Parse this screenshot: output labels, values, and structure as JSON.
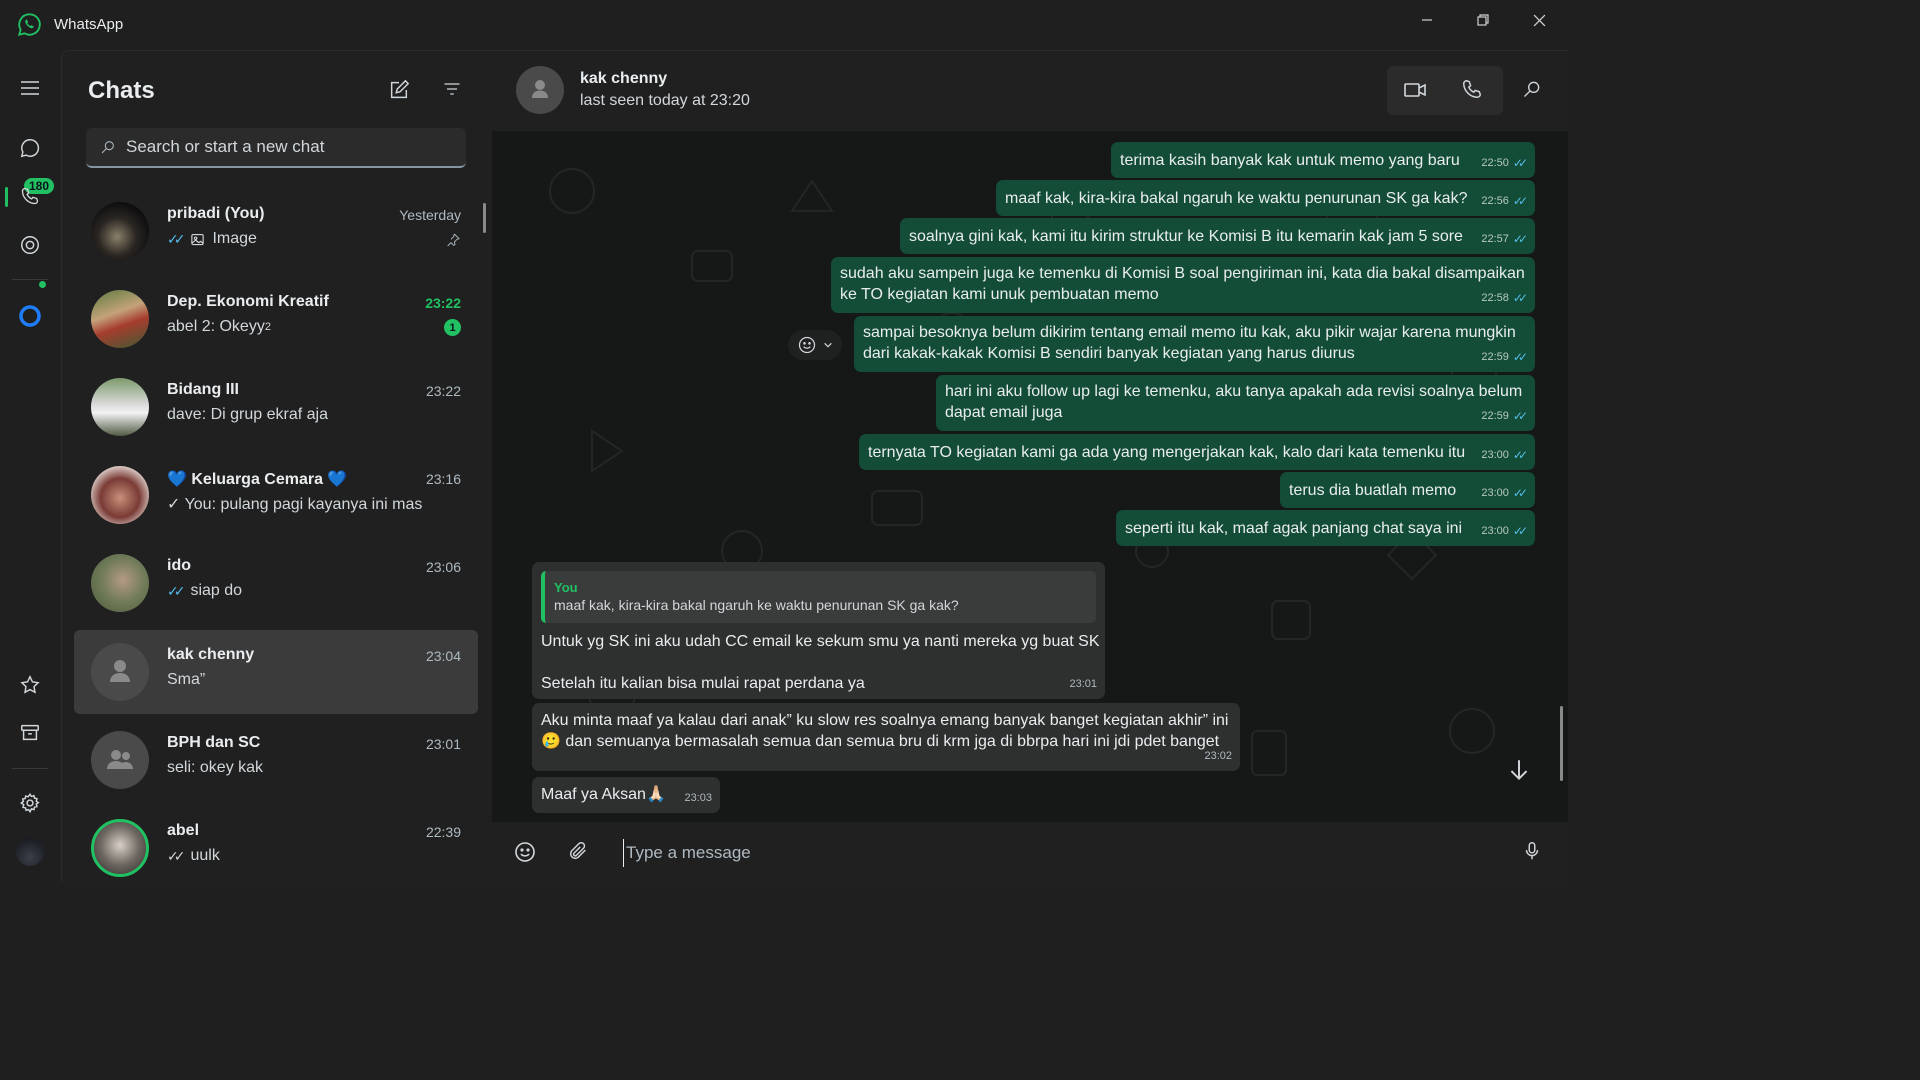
{
  "window": {
    "title": "WhatsApp",
    "icons": [
      "whatsapp-logo",
      "minimize-icon",
      "maximize-icon",
      "close-icon"
    ]
  },
  "rail": {
    "chats_badge": "180",
    "items": [
      "menu-icon",
      "chats-icon",
      "calls-icon",
      "status-icon",
      "meta-ai-icon",
      "starred-icon",
      "archive-icon",
      "settings-icon",
      "profile-avatar"
    ]
  },
  "sidebar": {
    "title": "Chats",
    "search_placeholder": "Search or start a new chat",
    "chats": [
      {
        "name": "pribadi (You)",
        "time": "Yesterday",
        "preview": "Image",
        "ticks": "read",
        "pinned": true,
        "media_icon": "image-icon"
      },
      {
        "name": "Dep. Ekonomi Kreatif",
        "time": "23:22",
        "preview": "abel 2: Okeyy",
        "preview_sup": "2",
        "unread": "1"
      },
      {
        "name": "Bidang III",
        "time": "23:22",
        "preview": "dave: Di grup ekraf aja"
      },
      {
        "name": "💙 Keluarga Cemara 💙",
        "time": "23:16",
        "preview": "✓ You: pulang pagi kayanya ini mas"
      },
      {
        "name": "ido",
        "time": "23:06",
        "preview": "siap do",
        "ticks": "read"
      },
      {
        "name": "kak chenny",
        "time": "23:04",
        "preview": "Sma”",
        "selected": true
      },
      {
        "name": "BPH dan SC",
        "time": "23:01",
        "preview": "seli: okey kak"
      },
      {
        "name": "abel",
        "time": "22:39",
        "preview": "uulk",
        "ticks": "grey"
      }
    ]
  },
  "conversation": {
    "contact_name": "kak chenny",
    "status": "last seen today at 23:20",
    "composer_placeholder": "Type a message",
    "messages": [
      {
        "dir": "out",
        "text": "terima kasih banyak kak untuk memo yang baru",
        "time": "22:50"
      },
      {
        "dir": "out",
        "text": "maaf kak, kira-kira bakal ngaruh ke waktu penurunan SK ga kak?",
        "time": "22:56"
      },
      {
        "dir": "out",
        "text": "soalnya gini kak, kami itu kirim struktur ke Komisi B itu kemarin kak jam 5 sore",
        "time": "22:57"
      },
      {
        "dir": "out",
        "text": "sudah aku sampein juga ke temenku di Komisi B soal pengiriman ini, kata dia bakal disampaikan\nke TO kegiatan kami unuk pembuatan memo",
        "time": "22:58"
      },
      {
        "dir": "out",
        "text": "sampai besoknya belum dikirim tentang email memo itu kak, aku pikir wajar karena mungkin\ndari kakak-kakak Komisi B sendiri banyak kegiatan yang harus diurus",
        "time": "22:59"
      },
      {
        "dir": "out",
        "text": "hari ini aku follow up lagi ke temenku, aku tanya apakah ada revisi soalnya belum\ndapat email juga",
        "time": "22:59"
      },
      {
        "dir": "out",
        "text": "ternyata TO kegiatan kami ga ada yang mengerjakan kak, kalo dari kata temenku itu",
        "time": "23:00"
      },
      {
        "dir": "out",
        "text": "terus dia buatlah memo",
        "time": "23:00"
      },
      {
        "dir": "out",
        "text": "seperti itu kak, maaf agak panjang chat saya ini",
        "time": "23:00"
      },
      {
        "dir": "in",
        "quote_name": "You",
        "quote_text": "maaf kak, kira-kira bakal ngaruh ke waktu penurunan SK ga kak?",
        "text": "Untuk yg SK ini aku udah CC email ke sekum smu ya nanti mereka yg buat SK\n\nSetelah itu kalian bisa mulai rapat perdana ya",
        "time": "23:01"
      },
      {
        "dir": "in",
        "text": "Aku minta maaf ya kalau dari anak” ku slow res soalnya emang banyak banget kegiatan akhir” ini\n🥲 dan semuanya bermasalah semua dan semua bru di krm jga di bbrpa hari ini jdi pdet banget",
        "time": "23:02"
      },
      {
        "dir": "in",
        "text": "Maaf ya Aksan🙏🏻",
        "time": "23:03"
      }
    ]
  },
  "colors": {
    "accent": "#21c063",
    "outgoing_bubble": "#144d37",
    "incoming_bubble": "#2e2f2f",
    "read_tick": "#53bdeb"
  }
}
